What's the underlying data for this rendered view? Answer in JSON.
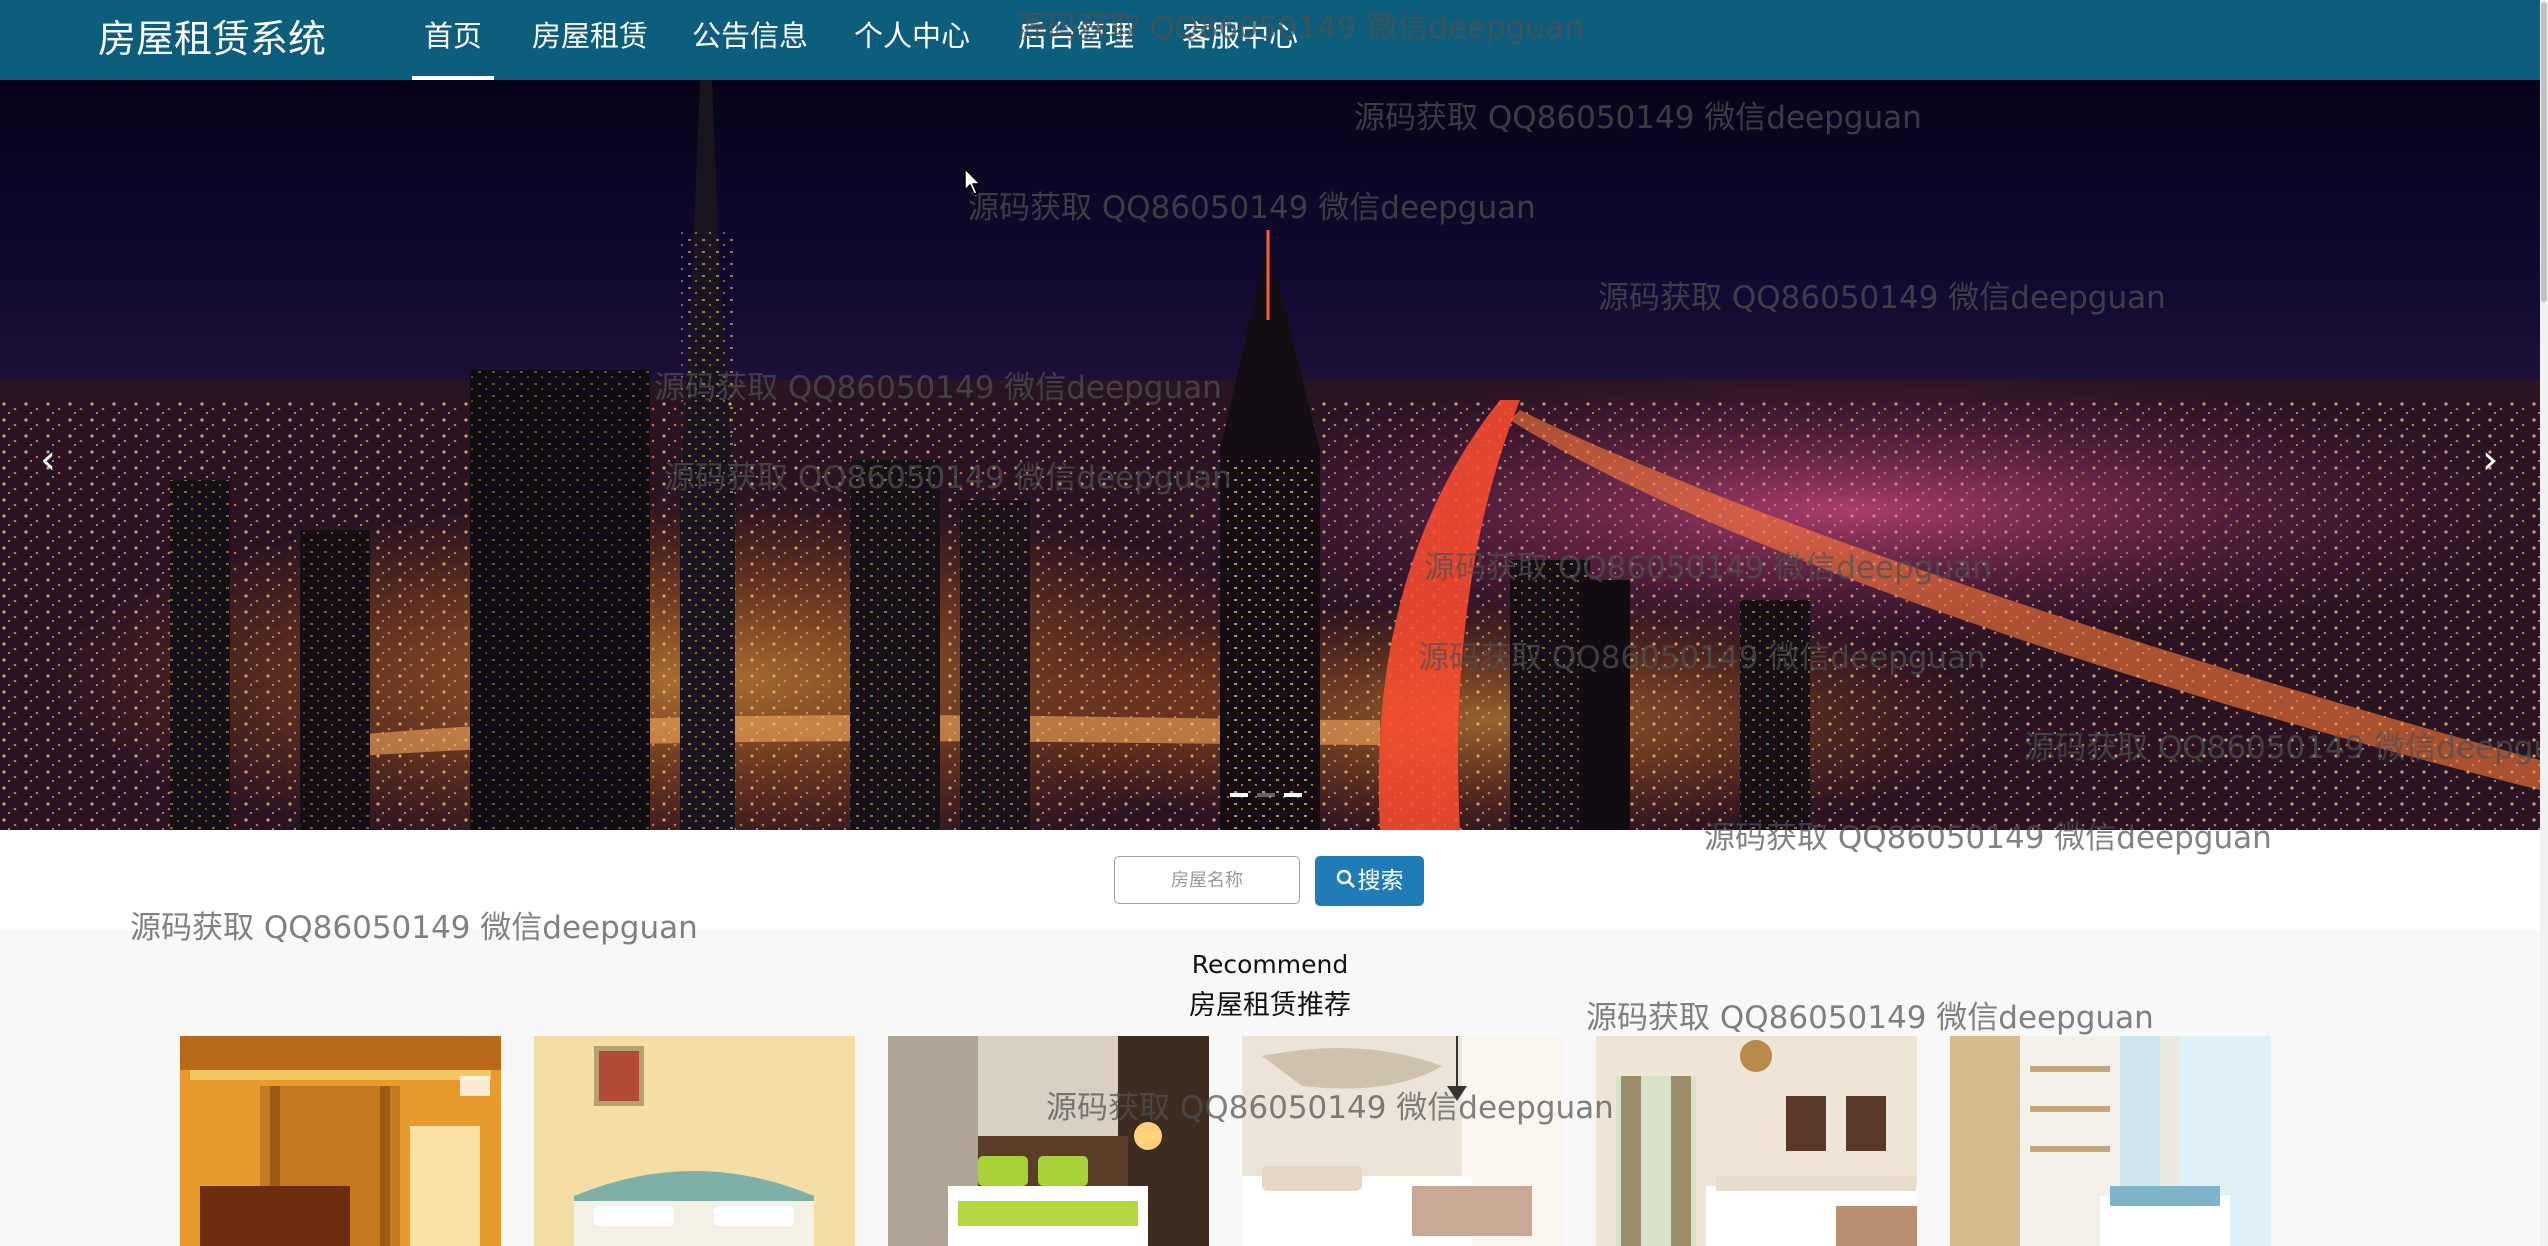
{
  "navbar": {
    "brand": "房屋租赁系统",
    "items": [
      {
        "label": "首页",
        "active": true
      },
      {
        "label": "房屋租赁"
      },
      {
        "label": "公告信息"
      },
      {
        "label": "个人中心"
      },
      {
        "label": "后台管理"
      },
      {
        "label": "客服中心"
      }
    ],
    "background": "#0d5e7c"
  },
  "carousel": {
    "prev_icon": "‹",
    "next_icon": "›",
    "slides": 3,
    "active_slide": 1
  },
  "search": {
    "placeholder": "房屋名称",
    "button_label": "搜索",
    "button_color": "#1f7cb6"
  },
  "recommend": {
    "title_en": "Recommend",
    "title_cn": "房屋租赁推荐",
    "cards": [
      {
        "image": "bedroom-photo-1"
      },
      {
        "image": "bedroom-photo-2"
      },
      {
        "image": "bedroom-photo-3"
      },
      {
        "image": "bedroom-photo-4"
      },
      {
        "image": "bedroom-photo-5"
      },
      {
        "image": "bedroom-photo-6"
      }
    ]
  },
  "watermark_text": "源码获取 QQ86050149 微信deepguan"
}
